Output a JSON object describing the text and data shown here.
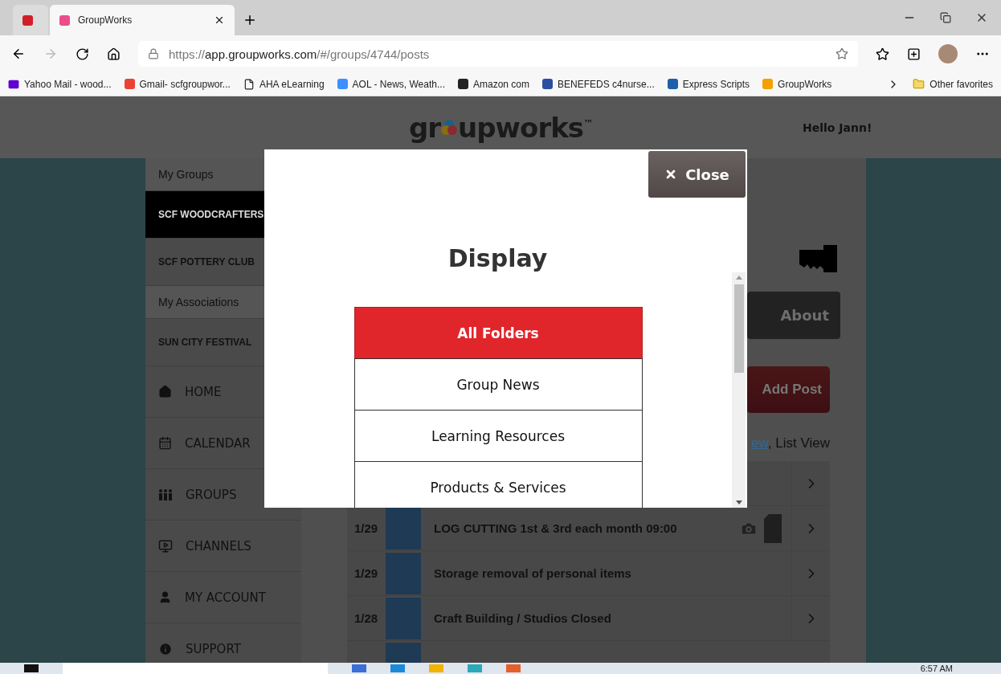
{
  "browser": {
    "tabs": [
      {
        "kind": "pinned",
        "selected": false
      },
      {
        "kind": "page",
        "title": "GroupWorks",
        "selected": true
      }
    ],
    "address": {
      "scheme": "https://",
      "host": "app.groupworks.com",
      "path": "/#/groups/4744/posts"
    },
    "bookmarks": [
      {
        "kind": "mail",
        "label": "Yahoo Mail - wood..."
      },
      {
        "kind": "gmail",
        "label": "Gmail- scfgroupwor..."
      },
      {
        "kind": "file",
        "label": "AHA eLearning"
      },
      {
        "kind": "aol",
        "label": "AOL - News, Weath..."
      },
      {
        "kind": "amazon",
        "label": "Amazon com"
      },
      {
        "kind": "flag",
        "label": "BENEFEDS c4nurse..."
      },
      {
        "kind": "express",
        "label": "Express Scripts"
      },
      {
        "kind": "groupworks",
        "label": "GroupWorks"
      }
    ],
    "other_favorites": "Other favorites"
  },
  "header": {
    "logo_start": "gr",
    "logo_end": "upworks",
    "logo_mark": "™",
    "greeting": "Hello Jann!"
  },
  "sidebar": {
    "items": [
      {
        "kind": "heading",
        "label": "My Groups",
        "selected": false
      },
      {
        "kind": "group",
        "label": "SCF WOODCRAFTERS",
        "selected": true
      },
      {
        "kind": "group",
        "label": "SCF POTTERY CLUB",
        "selected": false
      },
      {
        "kind": "heading",
        "label": "My Associations",
        "selected": false
      },
      {
        "kind": "group",
        "label": "SUN CITY FESTIVAL",
        "selected": false
      },
      {
        "kind": "home",
        "label": "HOME",
        "selected": false
      },
      {
        "kind": "calendar",
        "label": "CALENDAR",
        "selected": false
      },
      {
        "kind": "groups",
        "label": "GROUPS",
        "selected": false
      },
      {
        "kind": "channels",
        "label": "CHANNELS",
        "selected": false
      },
      {
        "kind": "account",
        "label": "MY ACCOUNT",
        "selected": false
      },
      {
        "kind": "support",
        "label": "SUPPORT",
        "selected": false
      }
    ]
  },
  "content": {
    "about": "About",
    "add_post": "Add Post",
    "view_link": "ew",
    "view_current": ", List View",
    "posts": [
      {
        "kind": "covered"
      },
      {
        "kind": "post",
        "date": "1/29",
        "title": "LOG CUTTING 1st & 3rd each month 09:00",
        "has_photo": true,
        "has_file": true
      },
      {
        "kind": "post",
        "date": "1/29",
        "title": "Storage removal of personal items",
        "has_photo": false,
        "has_file": false
      },
      {
        "kind": "post",
        "date": "1/28",
        "title": "Craft Building / Studios Closed",
        "has_photo": false,
        "has_file": false
      },
      {
        "kind": "cut"
      }
    ]
  },
  "modal": {
    "close": "Close",
    "title": "Display",
    "folders": [
      {
        "label": "All Folders",
        "selected": true
      },
      {
        "label": "Group News",
        "selected": false
      },
      {
        "label": "Learning Resources",
        "selected": false
      },
      {
        "label": "Products & Services",
        "selected": false
      }
    ]
  },
  "taskbar": {
    "time": "6:57 AM"
  }
}
